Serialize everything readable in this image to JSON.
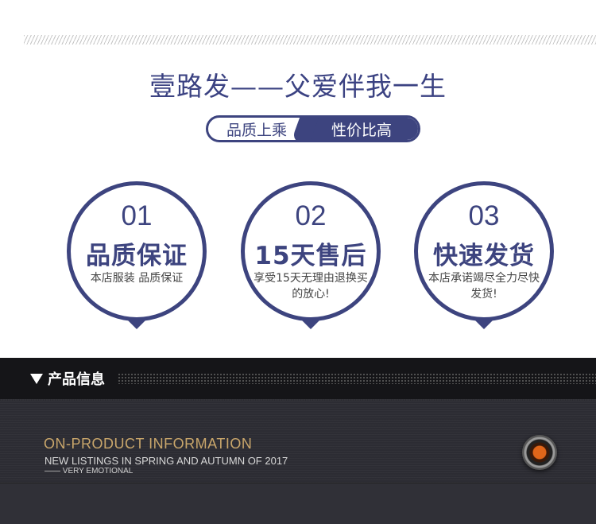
{
  "brand": {
    "title": "壹路发——父爱伴我一生"
  },
  "tagline": {
    "left": "品质上乘",
    "right": "性价比高"
  },
  "features": [
    {
      "number": "01",
      "heading": "品质保证",
      "desc": "本店服装 品质保证"
    },
    {
      "number": "02",
      "heading": "15天售后",
      "desc": "享受15天无理由退换买的放心!"
    },
    {
      "number": "03",
      "heading": "快速发货",
      "desc": "本店承诺竭尽全力尽快发货!"
    }
  ],
  "section": {
    "label": "产品信息"
  },
  "info": {
    "title": "ON-PRODUCT INFORMATION",
    "subtitle": "NEW LISTINGS IN SPRING AND AUTUMN OF 2017",
    "subtitle2": "—— VERY EMOTIONAL"
  },
  "colors": {
    "accent": "#3d447f",
    "gold": "#c9a66b",
    "dark": "#151518"
  },
  "icons": {
    "section_marker": "triangle-down-icon",
    "lens": "camera-lens-icon"
  }
}
